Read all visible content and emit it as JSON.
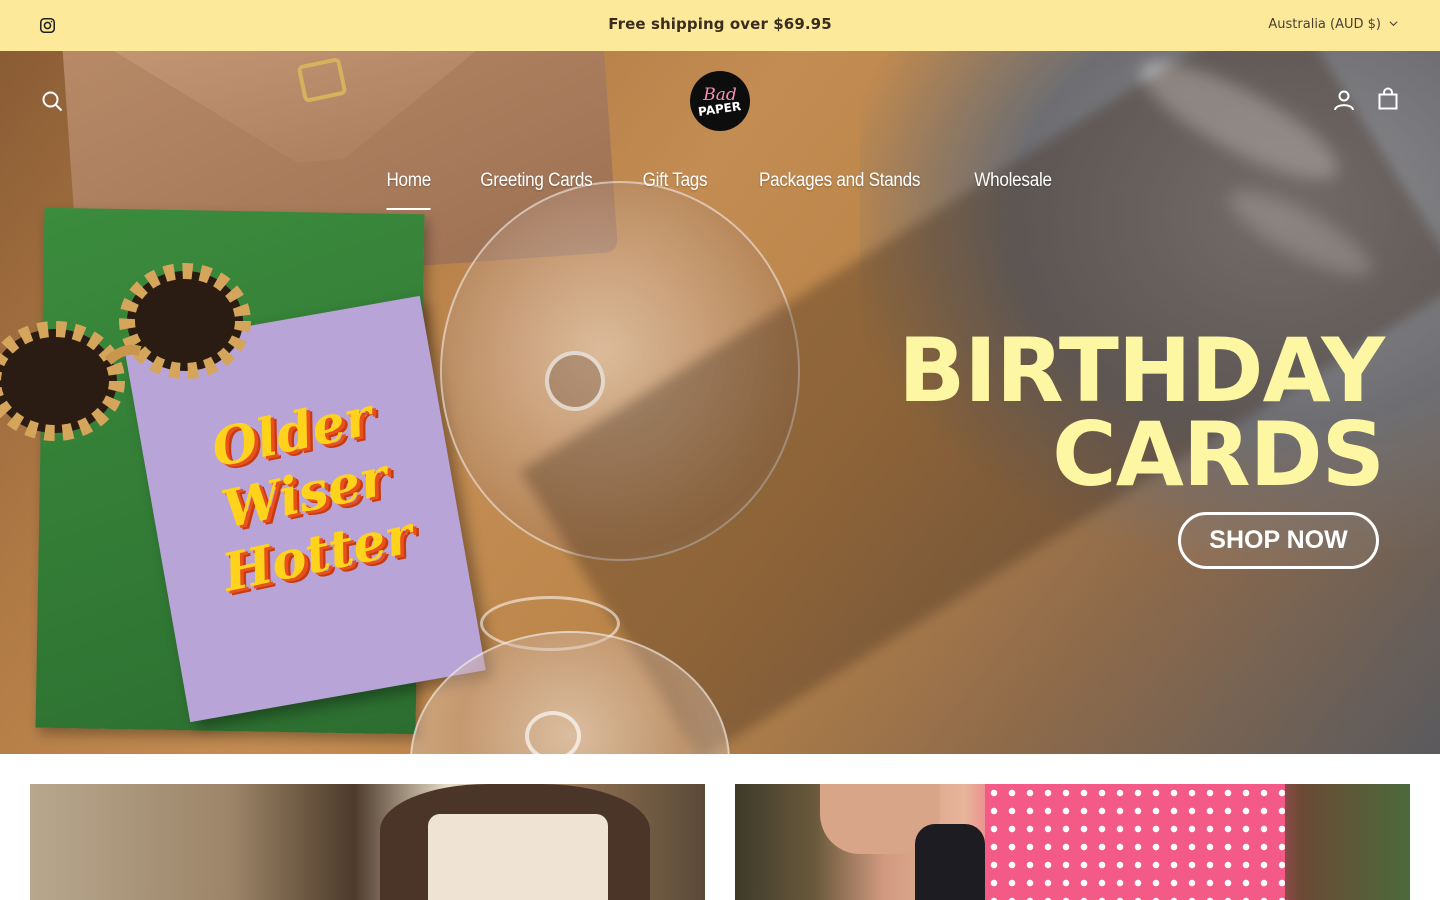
{
  "announcement": {
    "message": "Free shipping over $69.95",
    "country_selector": "Australia (AUD $)",
    "background_color": "#fde99a"
  },
  "header": {
    "logo_line1": "Bad",
    "logo_line2": "PAPER",
    "icons": [
      "instagram-icon",
      "search-icon",
      "account-icon",
      "cart-icon"
    ]
  },
  "nav": {
    "items": [
      {
        "label": "Home",
        "active": true
      },
      {
        "label": "Greeting Cards",
        "active": false
      },
      {
        "label": "Gift Tags",
        "active": false
      },
      {
        "label": "Packages and Stands",
        "active": false
      },
      {
        "label": "Wholesale",
        "active": false
      }
    ]
  },
  "hero": {
    "headline_line1": "BIRTHDAY",
    "headline_line2": "CARDS",
    "cta_label": "SHOP NOW",
    "card_text": "Older Wiser Hotter",
    "headline_color": "#fdf6a3"
  }
}
